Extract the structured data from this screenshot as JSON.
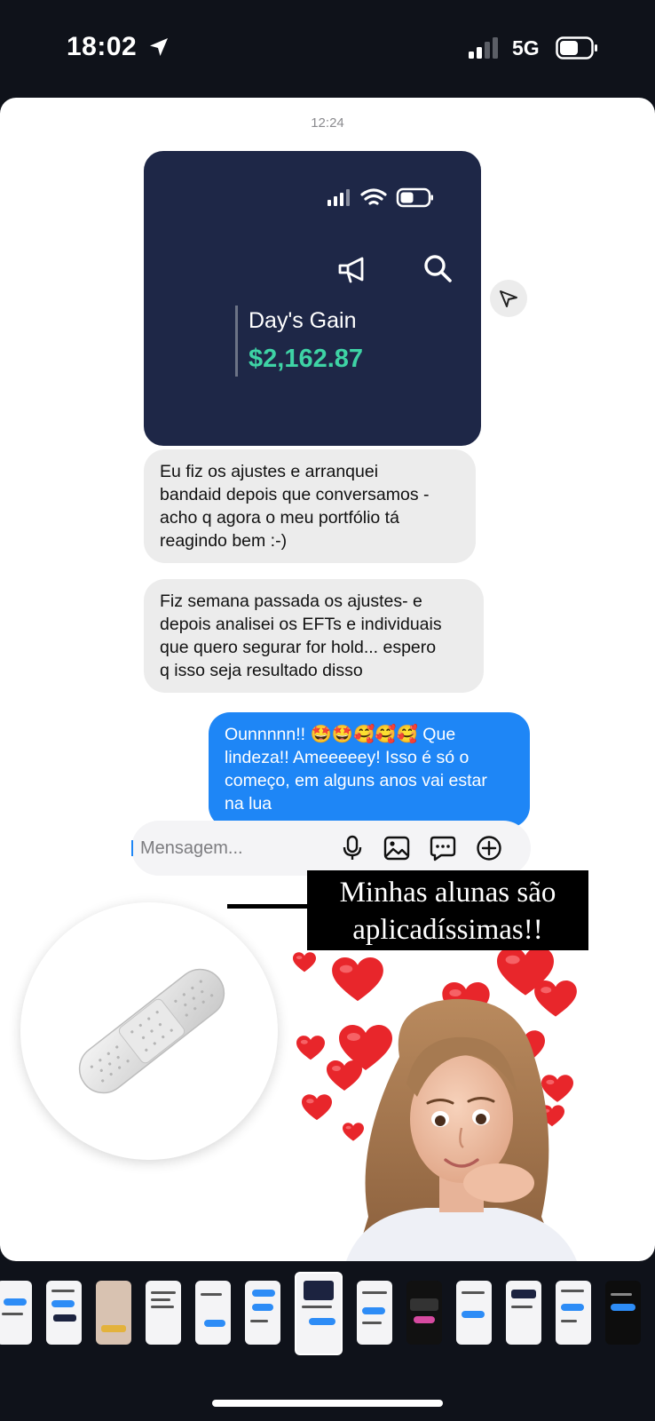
{
  "status_bar": {
    "time": "18:02",
    "network": "5G"
  },
  "chat": {
    "timestamp": "12:24",
    "shared_screenshot": {
      "gain_label": "Day's Gain",
      "gain_value": "$2,162.87"
    },
    "messages": [
      {
        "direction": "incoming",
        "text": "Eu fiz os ajustes e arranquei\nbandaid depois que conversamos -\nacho q agora o meu portfólio tá\nreagindo bem :-)"
      },
      {
        "direction": "incoming",
        "text": "Fiz semana passada os ajustes- e\ndepois analisei os EFTs e individuais\nque quero segurar for hold... espero\nq  isso seja resultado disso"
      },
      {
        "direction": "outgoing",
        "text": "Ounnnnn!! 🤩🤩🥰🥰🥰 Que\nlindeza!! Ameeeeey! Isso é só o\ncomeço, em alguns anos vai estar\nna lua"
      }
    ],
    "composer": {
      "placeholder": "Mensagem..."
    }
  },
  "caption": {
    "text": "Minhas alunas são\naplicadíssimas!!"
  },
  "colors": {
    "gain": "#3ed3a5",
    "screenshot_bg": "#1e2747",
    "outgoing_bubble": "#1e86f6",
    "incoming_bubble": "#ececec",
    "heart": "#e8262b"
  },
  "icons": [
    "location-arrow-icon",
    "signal-bars-icon",
    "battery-icon",
    "wifi-icon",
    "megaphone-icon",
    "search-icon",
    "share-icon",
    "microphone-icon",
    "image-icon",
    "sticker-icon",
    "plus-circle-icon"
  ],
  "thumbnails": {
    "count": 13,
    "active_index": 6
  }
}
